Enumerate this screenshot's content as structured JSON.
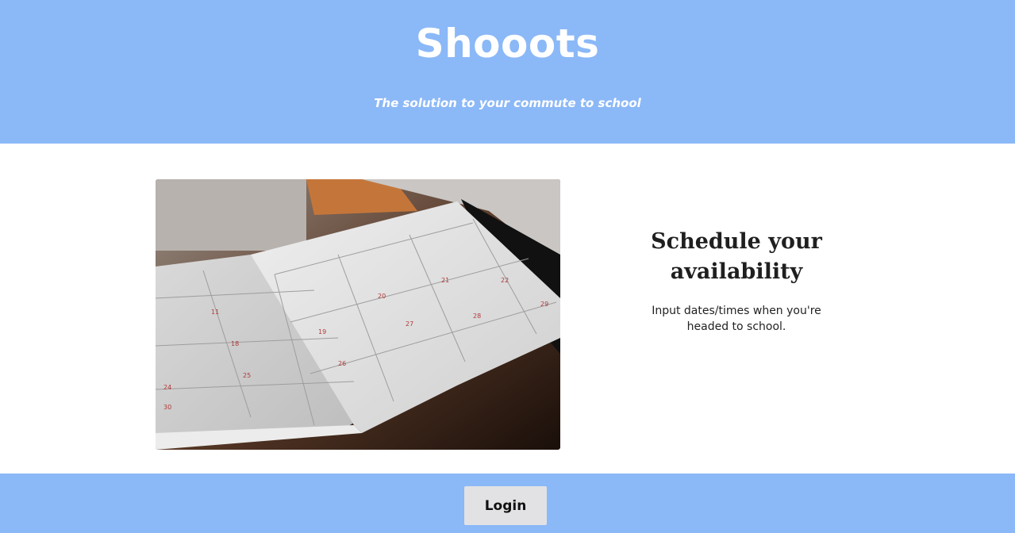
{
  "header": {
    "brand": "Shooots",
    "tagline": "The solution to your commute to school"
  },
  "feature": {
    "title": "Schedule your availability",
    "description": "Input dates/times when you're headed to school.",
    "image_alt": "open planner calendar"
  },
  "footer": {
    "login_label": "Login"
  },
  "colors": {
    "header_bg": "#8bb8f7",
    "footer_bg": "#8bb8f7",
    "button_bg": "#e2e2e4",
    "text_dark": "#1f1f1f"
  }
}
